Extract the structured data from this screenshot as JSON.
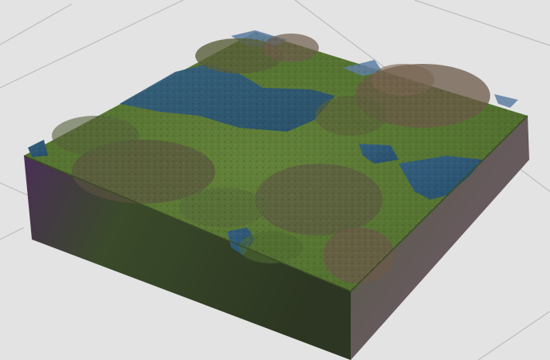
{
  "viewport": {
    "background_color": "#e3e3e3",
    "grid_color": "#b9b9b9"
  },
  "terrain": {
    "grass_color": "#5c7a35",
    "grass_dark_color": "#3f5524",
    "rock_color": "#6d5d4c",
    "water_color": "#2d5a78",
    "water_light_color": "#5f7fa3",
    "side_left_colors": [
      "#5e3a6b",
      "#3a4a2a",
      "#2f3a24"
    ],
    "side_right_colors": [
      "#4d5a3a",
      "#6a5a5f",
      "#556b45"
    ]
  }
}
